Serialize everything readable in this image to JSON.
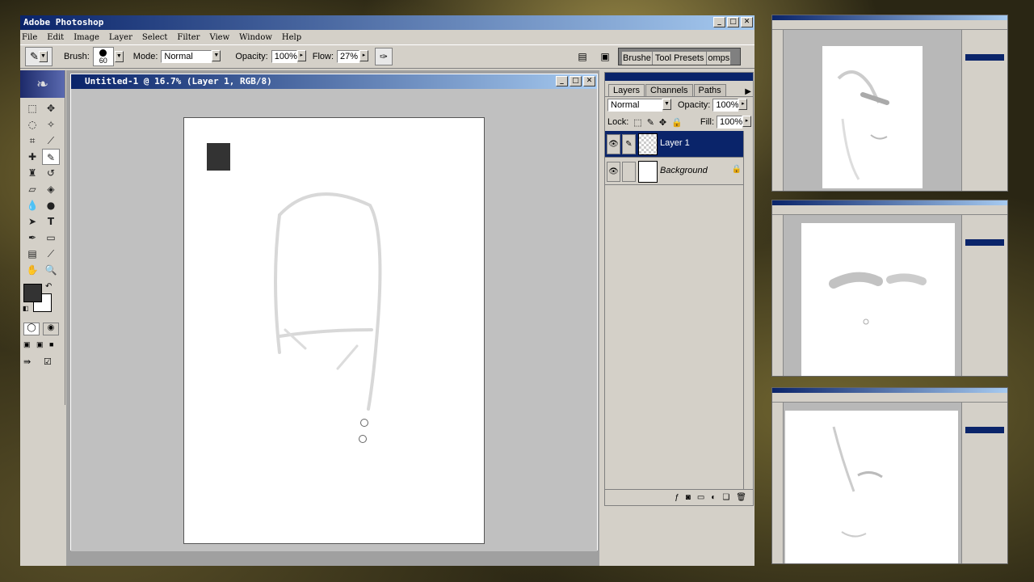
{
  "app": {
    "title": "Adobe Photoshop",
    "window_buttons": [
      "_",
      "□",
      "✕"
    ]
  },
  "menu": [
    "File",
    "Edit",
    "Image",
    "Layer",
    "Select",
    "Filter",
    "View",
    "Window",
    "Help"
  ],
  "options_bar": {
    "brush_label": "Brush:",
    "brush_size": "60",
    "mode_label": "Mode:",
    "mode_value": "Normal",
    "opacity_label": "Opacity:",
    "opacity_value": "100%",
    "flow_label": "Flow:",
    "flow_value": "27%",
    "palette_well_tabs": [
      "Brushe",
      "Tool Presets",
      "omps"
    ]
  },
  "document": {
    "title": "Untitled-1 @ 16.7% (Layer 1, RGB/8)"
  },
  "layers_palette": {
    "tabs": [
      "Layers",
      "Channels",
      "Paths"
    ],
    "blend_mode": "Normal",
    "opacity_label": "Opacity:",
    "opacity_value": "100%",
    "lock_label": "Lock:",
    "fill_label": "Fill:",
    "fill_value": "100%",
    "layers": [
      {
        "name": "Layer 1",
        "selected": true
      },
      {
        "name": "Background",
        "selected": false
      }
    ]
  },
  "colors": {
    "titlebar_start": "#0a246a",
    "titlebar_end": "#a6caf0",
    "foreground_swatch": "#333333",
    "background_swatch": "#ffffff"
  },
  "icons": [
    "eye-icon",
    "brush-link-icon",
    "lock-icon",
    "new-layer-icon",
    "trash-icon",
    "feather-icon"
  ]
}
